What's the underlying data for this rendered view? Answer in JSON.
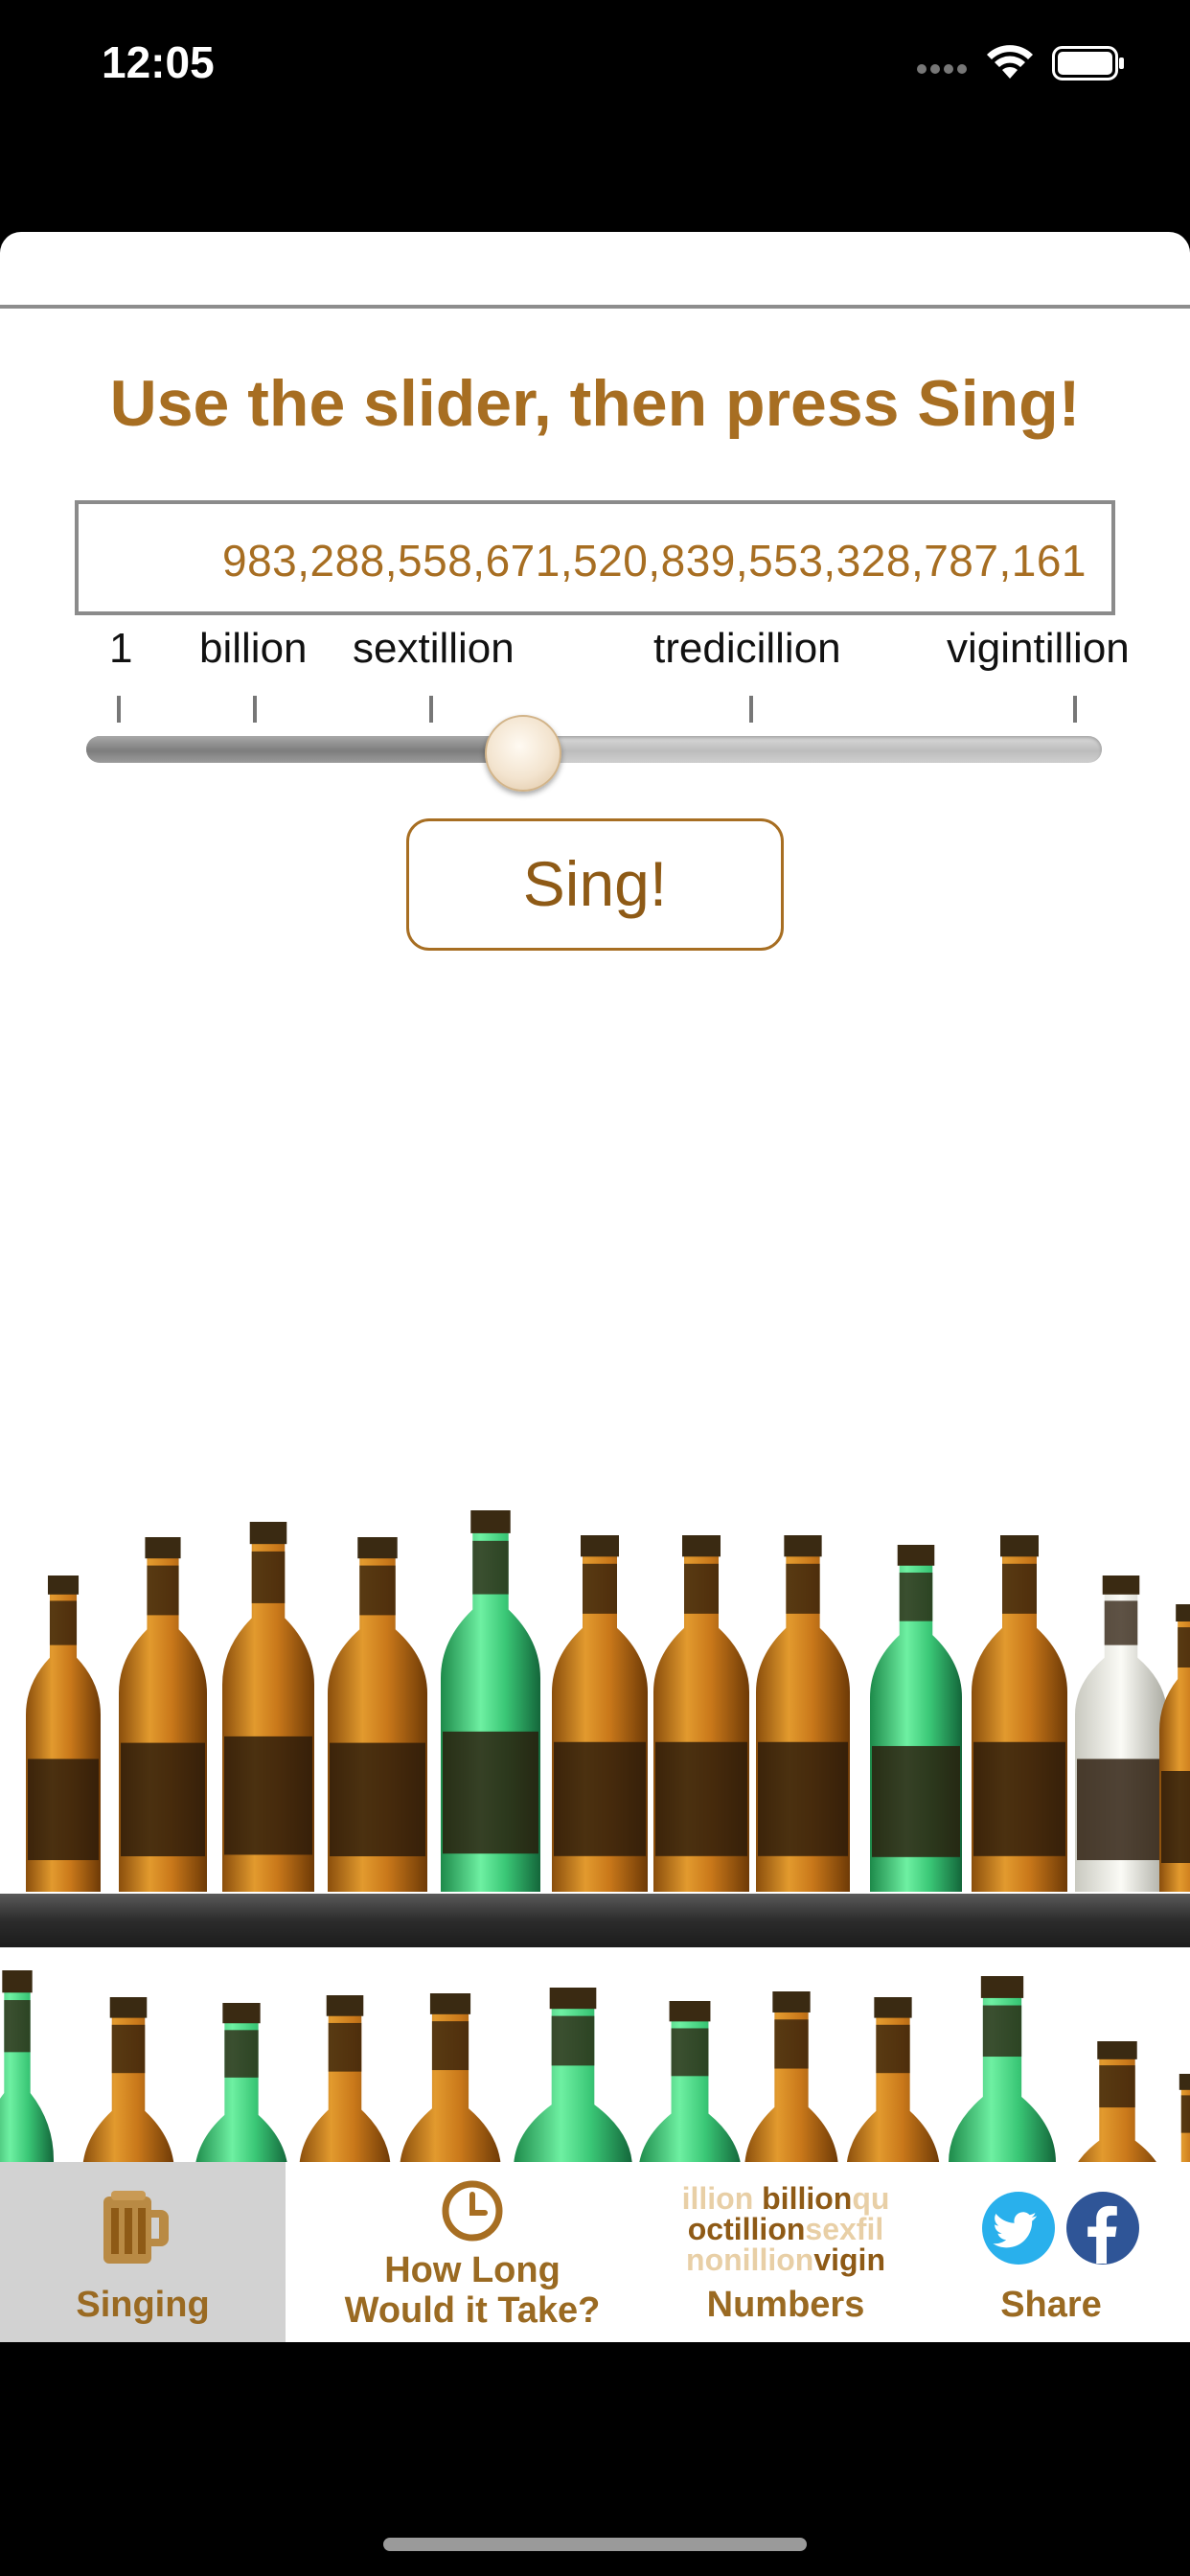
{
  "status_bar": {
    "time": "12:05"
  },
  "main": {
    "headline": "Use the slider, then press Sing!",
    "number_value": "983,288,558,671,520,839,553,328,787,161",
    "slider": {
      "tick_labels": [
        "1",
        "billion",
        "sextillion",
        "tredicillion",
        "vigintillion"
      ],
      "value_fraction": 0.43
    },
    "sing_button": "Sing!"
  },
  "tab_bar": {
    "singing": {
      "label": "Singing",
      "icon": "beer-mug-icon",
      "selected": true
    },
    "how_long": {
      "label_line1": "How Long",
      "label_line2": "Would it Take?",
      "icon": "clock-icon"
    },
    "numbers": {
      "label": "Numbers",
      "cloud_line1_a": "illion ",
      "cloud_line1_b": "billion",
      "cloud_line1_c": "qu",
      "cloud_line2_a": "octillion",
      "cloud_line2_b": "sexfil",
      "cloud_line3_a": "nonillion",
      "cloud_line3_b": "vigin"
    },
    "share": {
      "label": "Share",
      "icons": [
        "twitter-icon",
        "facebook-icon"
      ]
    }
  },
  "colors": {
    "accent": "#a76e22",
    "tab_selected_bg": "#d2d2d2"
  }
}
